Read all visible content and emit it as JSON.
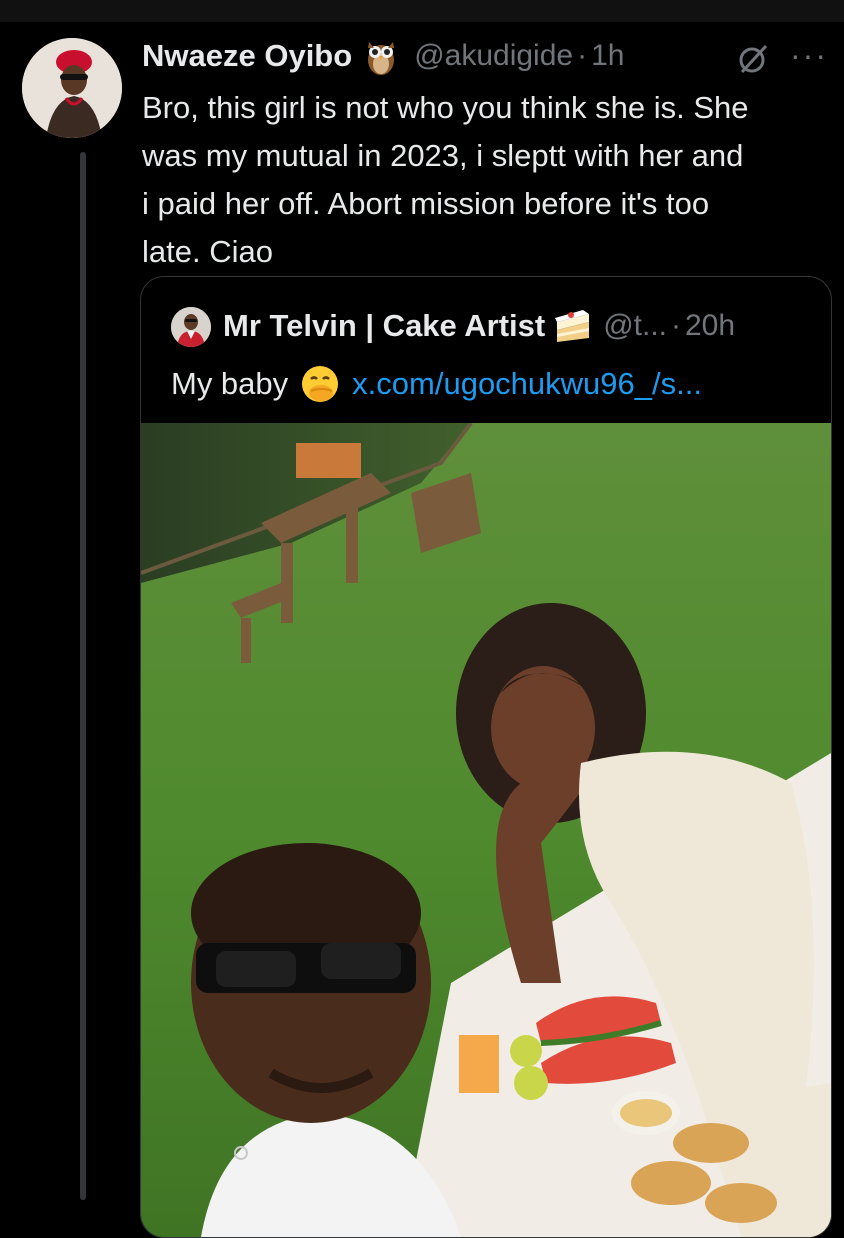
{
  "tweet": {
    "author_name": "Nwaeze Oyibo",
    "author_emoji_icon": "owl-icon",
    "handle": "@akudigide",
    "separator": "·",
    "time": "1h",
    "lines": [
      "Bro, this girl is not who you think she is. She",
      "was my mutual in 2023, i sleptt with her and",
      "i paid her off. Abort mission before it's too",
      "late. Ciao"
    ]
  },
  "quoted": {
    "author_name": "Mr Telvin | Cake Artist",
    "author_emoji_icon": "cake-icon",
    "handle": "@t...",
    "separator": "·",
    "time": "20h",
    "text": "My baby",
    "emoji_icon": "face-with-hand-over-mouth-icon",
    "link": "x.com/ugochukwu96_/s..."
  },
  "colors": {
    "background": "#000000",
    "text_primary": "#e7e9ea",
    "text_secondary": "#71767b",
    "link": "#1d9bf0",
    "border": "#333639"
  }
}
